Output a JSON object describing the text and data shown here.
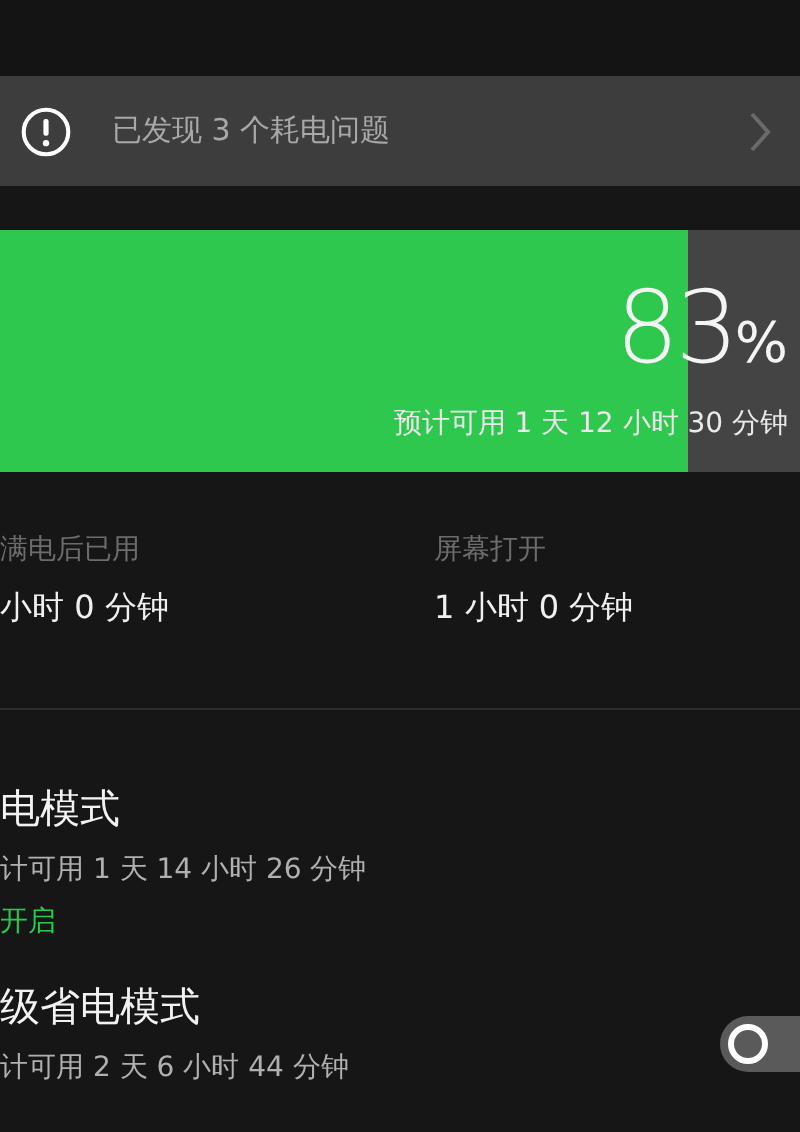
{
  "alert": {
    "text": "已发现 3 个耗电问题"
  },
  "battery": {
    "level": 0.86,
    "percent": "83",
    "unit": "%",
    "estimate": "预计可用 1 天 12 小时 30 分钟"
  },
  "stats": [
    {
      "label": "满电后已用",
      "value": "小时 0 分钟"
    },
    {
      "label": "屏幕打开",
      "value": "1 小时 0 分钟"
    }
  ],
  "modes": [
    {
      "title": "电模式",
      "estimate": "计可用 1 天 14 小时 26 分钟",
      "status": "开启"
    },
    {
      "title": "级省电模式",
      "estimate": "计可用 2 天 6 小时 44 分钟",
      "switch": {
        "on": false
      }
    }
  ]
}
